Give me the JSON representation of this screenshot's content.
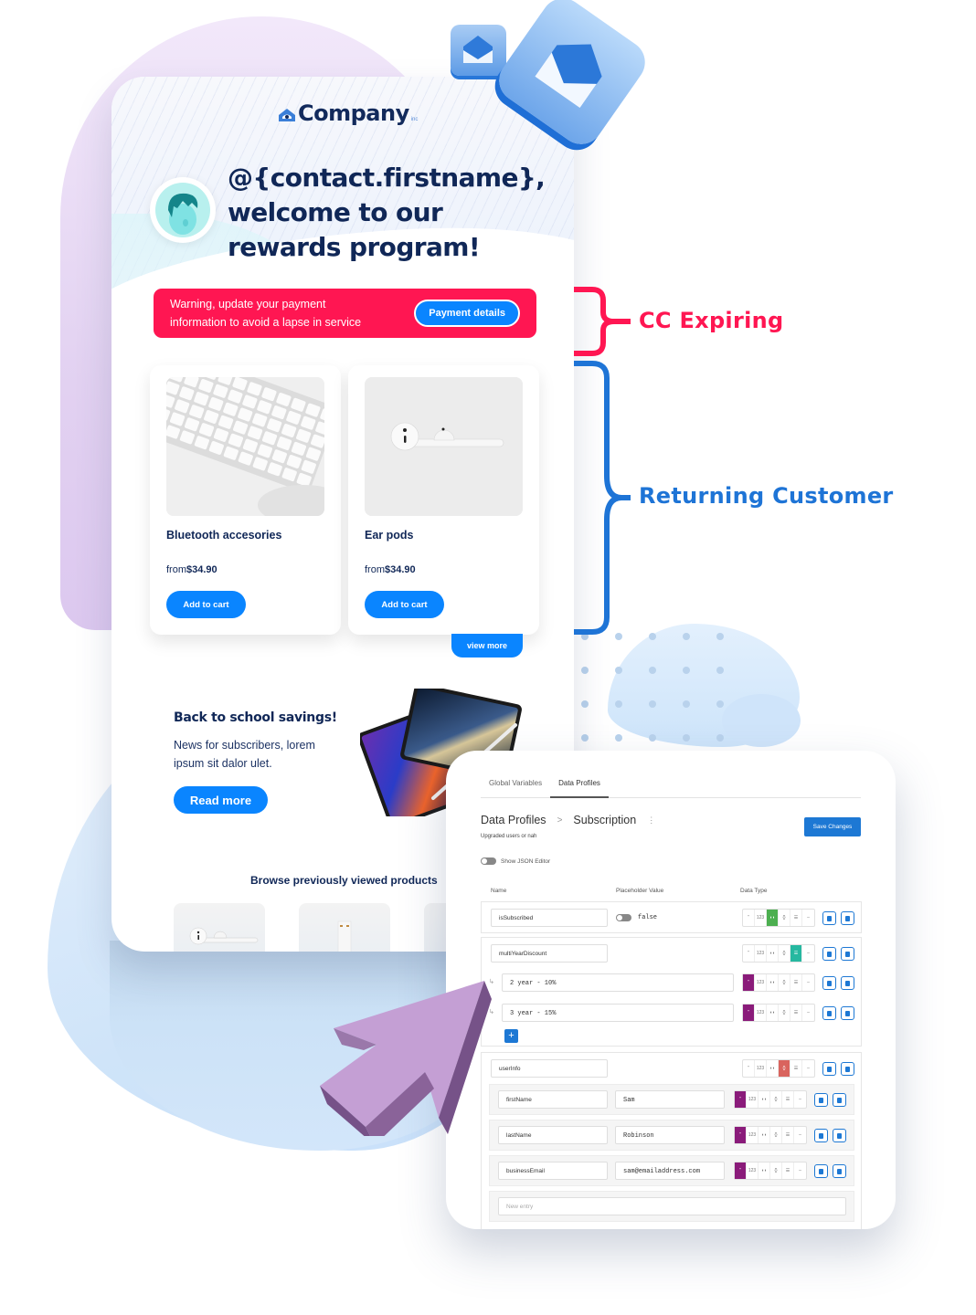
{
  "annotations": {
    "cc_expiring": "CC Expiring",
    "returning_customer": "Returning Customer",
    "cc_color": "#ff1652",
    "returning_color": "#1e74d6"
  },
  "email": {
    "logo_text": "Company",
    "logo_suffix": "inc",
    "greeting_line1": "@{contact.firstname},",
    "greeting_line2": "welcome to our",
    "greeting_line3": "rewards program!",
    "warning": {
      "text": "Warning, update your payment information to avoid a lapse in service",
      "button": "Payment details"
    },
    "products": [
      {
        "name": "Bluetooth accesories",
        "price_prefix": "from",
        "price": "$34.90",
        "button": "Add to cart"
      },
      {
        "name": "Ear pods",
        "price_prefix": "from",
        "price": "$34.90",
        "button": "Add to cart"
      }
    ],
    "view_more": "view more",
    "promo": {
      "title": "Back to school savings!",
      "body": "News for subscribers, lorem ipsum sit dalor ulet.",
      "button": "Read more"
    },
    "browse_title": "Browse previously viewed products"
  },
  "panel": {
    "tabs": [
      {
        "label": "Global Variables",
        "active": false
      },
      {
        "label": "Data Profiles",
        "active": true
      }
    ],
    "breadcrumb": {
      "parent": "Data Profiles",
      "separator": ">",
      "current": "Subscription"
    },
    "subtitle": "Upgraded users or nah",
    "save_button": "Save Changes",
    "json_toggle_label": "Show JSON Editor",
    "columns": {
      "name": "Name",
      "placeholder": "Placeholder Value",
      "type": "Data Type"
    },
    "type_chips": [
      "”",
      "123",
      "bool",
      "{}",
      "list",
      "–"
    ],
    "rows": {
      "is_subscribed": {
        "name": "isSubscribed",
        "value": "false",
        "type": "boolean"
      },
      "multi_year": {
        "name": "multiYearDiscount",
        "type": "list",
        "items": [
          {
            "value": "2 year - 10%",
            "type": "string"
          },
          {
            "value": "3 year - 15%",
            "type": "string"
          }
        ],
        "add_label": "+"
      },
      "user_info": {
        "name": "userInfo",
        "type": "object",
        "children": [
          {
            "name": "firstName",
            "value": "Sam",
            "type": "string"
          },
          {
            "name": "lastName",
            "value": "Robinson",
            "type": "string"
          },
          {
            "name": "businessEmail",
            "value": "sam@emailaddress.com",
            "type": "string"
          }
        ],
        "new_entry_placeholder": "New entry"
      }
    }
  }
}
